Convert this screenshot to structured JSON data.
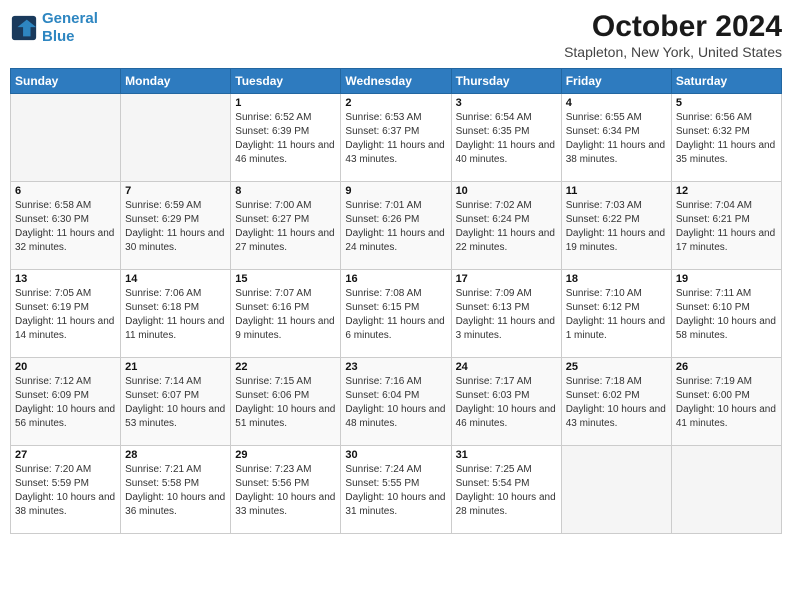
{
  "header": {
    "logo_line1": "General",
    "logo_line2": "Blue",
    "month": "October 2024",
    "location": "Stapleton, New York, United States"
  },
  "days_of_week": [
    "Sunday",
    "Monday",
    "Tuesday",
    "Wednesday",
    "Thursday",
    "Friday",
    "Saturday"
  ],
  "weeks": [
    [
      {
        "day": "",
        "sunrise": "",
        "sunset": "",
        "daylight": ""
      },
      {
        "day": "",
        "sunrise": "",
        "sunset": "",
        "daylight": ""
      },
      {
        "day": "1",
        "sunrise": "Sunrise: 6:52 AM",
        "sunset": "Sunset: 6:39 PM",
        "daylight": "Daylight: 11 hours and 46 minutes."
      },
      {
        "day": "2",
        "sunrise": "Sunrise: 6:53 AM",
        "sunset": "Sunset: 6:37 PM",
        "daylight": "Daylight: 11 hours and 43 minutes."
      },
      {
        "day": "3",
        "sunrise": "Sunrise: 6:54 AM",
        "sunset": "Sunset: 6:35 PM",
        "daylight": "Daylight: 11 hours and 40 minutes."
      },
      {
        "day": "4",
        "sunrise": "Sunrise: 6:55 AM",
        "sunset": "Sunset: 6:34 PM",
        "daylight": "Daylight: 11 hours and 38 minutes."
      },
      {
        "day": "5",
        "sunrise": "Sunrise: 6:56 AM",
        "sunset": "Sunset: 6:32 PM",
        "daylight": "Daylight: 11 hours and 35 minutes."
      }
    ],
    [
      {
        "day": "6",
        "sunrise": "Sunrise: 6:58 AM",
        "sunset": "Sunset: 6:30 PM",
        "daylight": "Daylight: 11 hours and 32 minutes."
      },
      {
        "day": "7",
        "sunrise": "Sunrise: 6:59 AM",
        "sunset": "Sunset: 6:29 PM",
        "daylight": "Daylight: 11 hours and 30 minutes."
      },
      {
        "day": "8",
        "sunrise": "Sunrise: 7:00 AM",
        "sunset": "Sunset: 6:27 PM",
        "daylight": "Daylight: 11 hours and 27 minutes."
      },
      {
        "day": "9",
        "sunrise": "Sunrise: 7:01 AM",
        "sunset": "Sunset: 6:26 PM",
        "daylight": "Daylight: 11 hours and 24 minutes."
      },
      {
        "day": "10",
        "sunrise": "Sunrise: 7:02 AM",
        "sunset": "Sunset: 6:24 PM",
        "daylight": "Daylight: 11 hours and 22 minutes."
      },
      {
        "day": "11",
        "sunrise": "Sunrise: 7:03 AM",
        "sunset": "Sunset: 6:22 PM",
        "daylight": "Daylight: 11 hours and 19 minutes."
      },
      {
        "day": "12",
        "sunrise": "Sunrise: 7:04 AM",
        "sunset": "Sunset: 6:21 PM",
        "daylight": "Daylight: 11 hours and 17 minutes."
      }
    ],
    [
      {
        "day": "13",
        "sunrise": "Sunrise: 7:05 AM",
        "sunset": "Sunset: 6:19 PM",
        "daylight": "Daylight: 11 hours and 14 minutes."
      },
      {
        "day": "14",
        "sunrise": "Sunrise: 7:06 AM",
        "sunset": "Sunset: 6:18 PM",
        "daylight": "Daylight: 11 hours and 11 minutes."
      },
      {
        "day": "15",
        "sunrise": "Sunrise: 7:07 AM",
        "sunset": "Sunset: 6:16 PM",
        "daylight": "Daylight: 11 hours and 9 minutes."
      },
      {
        "day": "16",
        "sunrise": "Sunrise: 7:08 AM",
        "sunset": "Sunset: 6:15 PM",
        "daylight": "Daylight: 11 hours and 6 minutes."
      },
      {
        "day": "17",
        "sunrise": "Sunrise: 7:09 AM",
        "sunset": "Sunset: 6:13 PM",
        "daylight": "Daylight: 11 hours and 3 minutes."
      },
      {
        "day": "18",
        "sunrise": "Sunrise: 7:10 AM",
        "sunset": "Sunset: 6:12 PM",
        "daylight": "Daylight: 11 hours and 1 minute."
      },
      {
        "day": "19",
        "sunrise": "Sunrise: 7:11 AM",
        "sunset": "Sunset: 6:10 PM",
        "daylight": "Daylight: 10 hours and 58 minutes."
      }
    ],
    [
      {
        "day": "20",
        "sunrise": "Sunrise: 7:12 AM",
        "sunset": "Sunset: 6:09 PM",
        "daylight": "Daylight: 10 hours and 56 minutes."
      },
      {
        "day": "21",
        "sunrise": "Sunrise: 7:14 AM",
        "sunset": "Sunset: 6:07 PM",
        "daylight": "Daylight: 10 hours and 53 minutes."
      },
      {
        "day": "22",
        "sunrise": "Sunrise: 7:15 AM",
        "sunset": "Sunset: 6:06 PM",
        "daylight": "Daylight: 10 hours and 51 minutes."
      },
      {
        "day": "23",
        "sunrise": "Sunrise: 7:16 AM",
        "sunset": "Sunset: 6:04 PM",
        "daylight": "Daylight: 10 hours and 48 minutes."
      },
      {
        "day": "24",
        "sunrise": "Sunrise: 7:17 AM",
        "sunset": "Sunset: 6:03 PM",
        "daylight": "Daylight: 10 hours and 46 minutes."
      },
      {
        "day": "25",
        "sunrise": "Sunrise: 7:18 AM",
        "sunset": "Sunset: 6:02 PM",
        "daylight": "Daylight: 10 hours and 43 minutes."
      },
      {
        "day": "26",
        "sunrise": "Sunrise: 7:19 AM",
        "sunset": "Sunset: 6:00 PM",
        "daylight": "Daylight: 10 hours and 41 minutes."
      }
    ],
    [
      {
        "day": "27",
        "sunrise": "Sunrise: 7:20 AM",
        "sunset": "Sunset: 5:59 PM",
        "daylight": "Daylight: 10 hours and 38 minutes."
      },
      {
        "day": "28",
        "sunrise": "Sunrise: 7:21 AM",
        "sunset": "Sunset: 5:58 PM",
        "daylight": "Daylight: 10 hours and 36 minutes."
      },
      {
        "day": "29",
        "sunrise": "Sunrise: 7:23 AM",
        "sunset": "Sunset: 5:56 PM",
        "daylight": "Daylight: 10 hours and 33 minutes."
      },
      {
        "day": "30",
        "sunrise": "Sunrise: 7:24 AM",
        "sunset": "Sunset: 5:55 PM",
        "daylight": "Daylight: 10 hours and 31 minutes."
      },
      {
        "day": "31",
        "sunrise": "Sunrise: 7:25 AM",
        "sunset": "Sunset: 5:54 PM",
        "daylight": "Daylight: 10 hours and 28 minutes."
      },
      {
        "day": "",
        "sunrise": "",
        "sunset": "",
        "daylight": ""
      },
      {
        "day": "",
        "sunrise": "",
        "sunset": "",
        "daylight": ""
      }
    ]
  ]
}
